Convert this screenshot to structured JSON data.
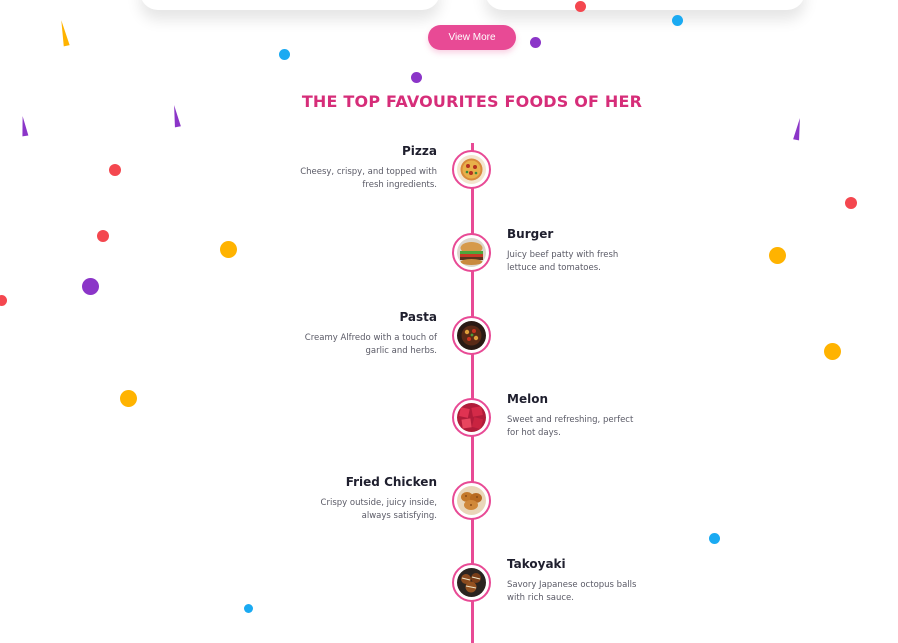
{
  "colors": {
    "accent": "#e84a95",
    "title": "#d62d79",
    "text_dark": "#1f1f2e",
    "text_muted": "#5a5a66",
    "confetti_red": "#f4474f",
    "confetti_blue": "#1aaaf2",
    "confetti_purple": "#8b35c8",
    "confetti_yellow": "#ffb300"
  },
  "buttons": {
    "view_more": "View More"
  },
  "section": {
    "title": "THE TOP FAVOURITES FOODS OF HER"
  },
  "foods": [
    {
      "name": "Pizza",
      "description": "Cheesy, crispy, and topped with fresh ingredients.",
      "icon": "pizza-photo"
    },
    {
      "name": "Burger",
      "description": "Juicy beef patty with fresh lettuce and tomatoes.",
      "icon": "burger-photo"
    },
    {
      "name": "Pasta",
      "description": "Creamy Alfredo with a touch of garlic and herbs.",
      "icon": "pasta-photo"
    },
    {
      "name": "Melon",
      "description": "Sweet and refreshing, perfect for hot days.",
      "icon": "melon-photo"
    },
    {
      "name": "Fried Chicken",
      "description": "Crispy outside, juicy inside, always satisfying.",
      "icon": "fried-chicken-photo"
    },
    {
      "name": "Takoyaki",
      "description": "Savory Japanese octopus balls with rich sauce.",
      "icon": "takoyaki-photo"
    }
  ]
}
